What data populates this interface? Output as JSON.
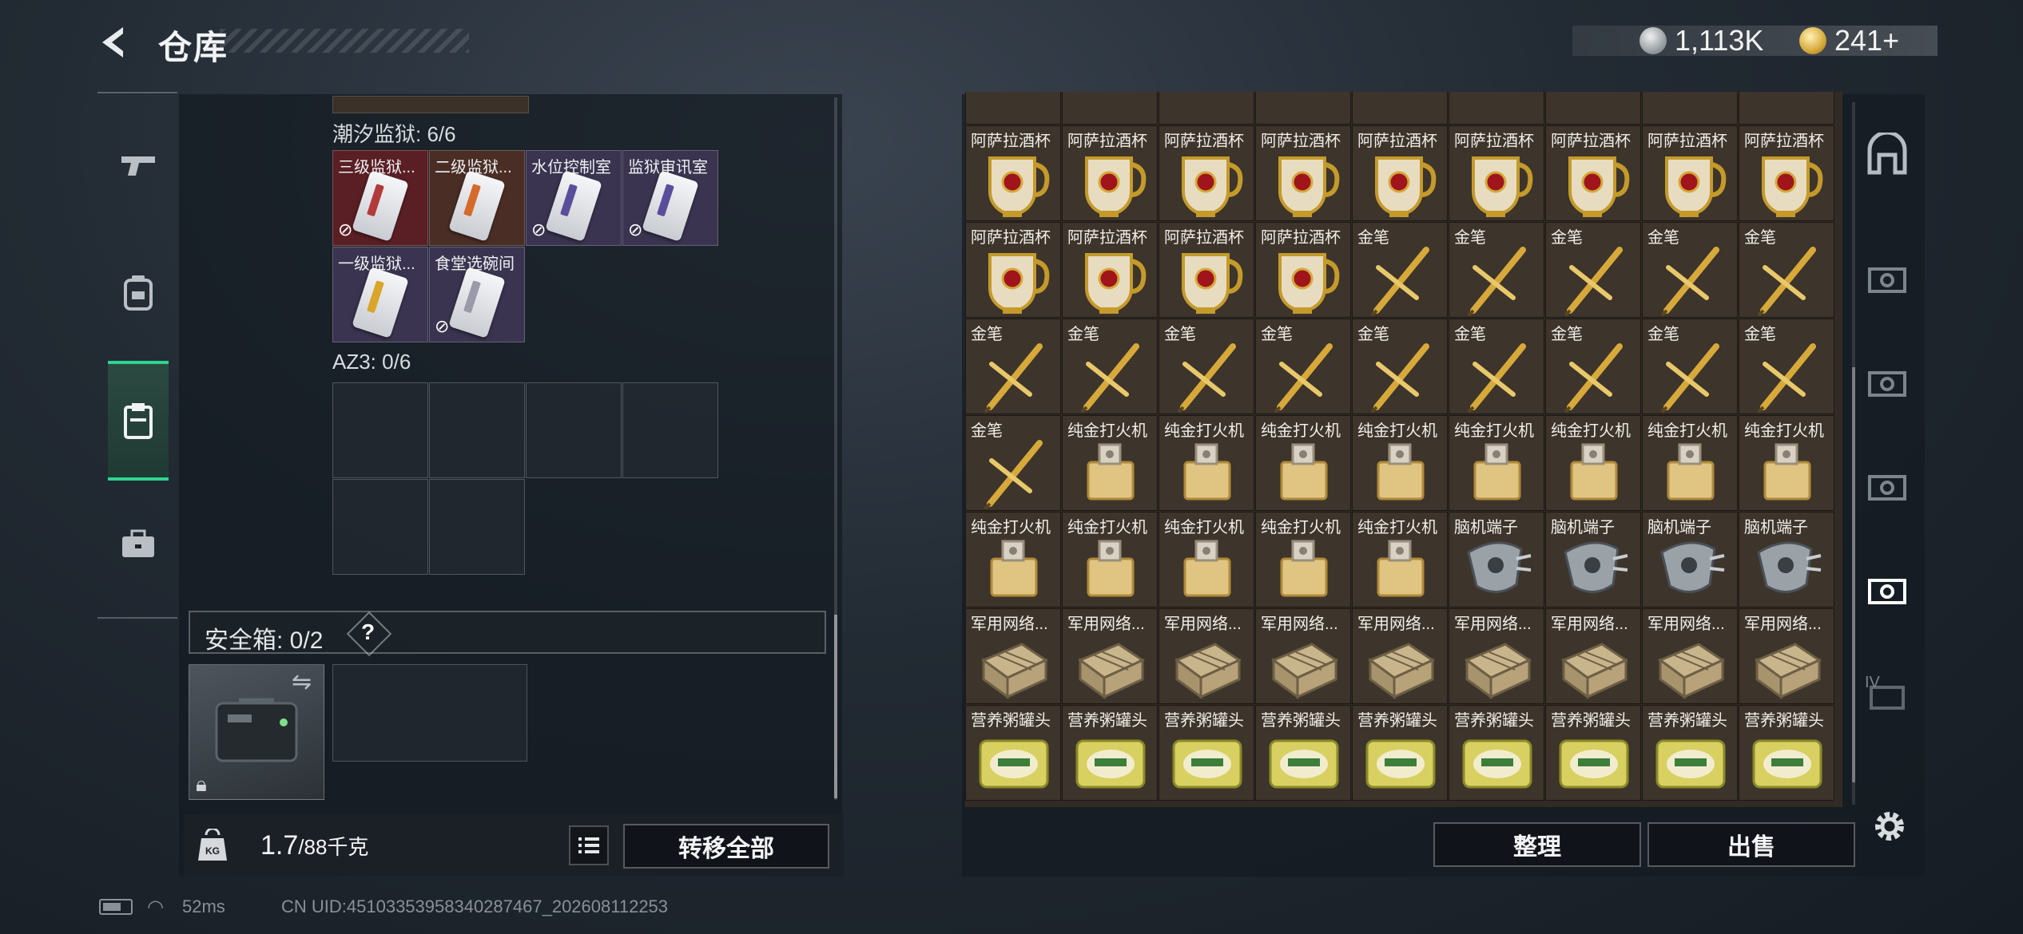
{
  "header": {
    "title": "仓库"
  },
  "currency": {
    "silver": "1,113K",
    "gold": "241+"
  },
  "left_categories": [
    {
      "name": "weapons-tab",
      "icon": "pistol-icon",
      "active": false
    },
    {
      "name": "armor-tab",
      "icon": "backpack-icon",
      "active": false
    },
    {
      "name": "containers-tab",
      "icon": "clipboard-icon",
      "active": true
    },
    {
      "name": "cases-tab",
      "icon": "briefcase-icon",
      "active": false
    }
  ],
  "keycard_case_1": {
    "label": "潮汐监狱: 6/6",
    "cards": [
      "三级监狱...",
      "二级监狱...",
      "水位控制室",
      "监狱审讯室",
      "一级监狱...",
      "食堂选碗间"
    ]
  },
  "keycard_case_2": {
    "label": "AZ3: 0/6"
  },
  "safe_box": {
    "label": "安全箱: 0/2",
    "help": "?"
  },
  "weight": {
    "current": "1.7",
    "max": "/88千克"
  },
  "buttons": {
    "transfer_all": "转移全部",
    "sort": "整理",
    "sell": "出售"
  },
  "stash_rows": [
    [
      "阿萨拉酒杯",
      "阿萨拉酒杯",
      "阿萨拉酒杯",
      "阿萨拉酒杯",
      "阿萨拉酒杯",
      "阿萨拉酒杯",
      "阿萨拉酒杯",
      "阿萨拉酒杯",
      "阿萨拉酒杯"
    ],
    [
      "阿萨拉酒杯",
      "阿萨拉酒杯",
      "阿萨拉酒杯",
      "阿萨拉酒杯",
      "金笔",
      "金笔",
      "金笔",
      "金笔",
      "金笔"
    ],
    [
      "金笔",
      "金笔",
      "金笔",
      "金笔",
      "金笔",
      "金笔",
      "金笔",
      "金笔",
      "金笔"
    ],
    [
      "金笔",
      "纯金打火机",
      "纯金打火机",
      "纯金打火机",
      "纯金打火机",
      "纯金打火机",
      "纯金打火机",
      "纯金打火机",
      "纯金打火机"
    ],
    [
      "纯金打火机",
      "纯金打火机",
      "纯金打火机",
      "纯金打火机",
      "纯金打火机",
      "脑机端子",
      "脑机端子",
      "脑机端子",
      "脑机端子"
    ],
    [
      "军用网络...",
      "军用网络...",
      "军用网络...",
      "军用网络...",
      "军用网络...",
      "军用网络...",
      "军用网络...",
      "军用网络...",
      "军用网络..."
    ],
    [
      "营养粥罐头",
      "营养粥罐头",
      "营养粥罐头",
      "营养粥罐头",
      "营养粥罐头",
      "营养粥罐头",
      "营养粥罐头",
      "营养粥罐头",
      "营养粥罐头"
    ]
  ],
  "right_rail": [
    {
      "name": "rail-stash-icon",
      "active": false
    },
    {
      "name": "rail-page-1-icon",
      "active": false
    },
    {
      "name": "rail-page-2-icon",
      "active": false
    },
    {
      "name": "rail-page-3-icon",
      "active": false
    },
    {
      "name": "rail-page-4-icon",
      "active": true
    },
    {
      "name": "rail-page-5-icon",
      "label": "IV",
      "active": false
    }
  ],
  "status_bar": {
    "ping": "52ms",
    "uid": "CN UID:451033539583402874​67_202608112253"
  },
  "colors": {
    "accent": "#2fd48f",
    "stash_cell": "#3d342b",
    "keycard_red": "#5a1f24",
    "keycard_purple": "#3a3450"
  }
}
